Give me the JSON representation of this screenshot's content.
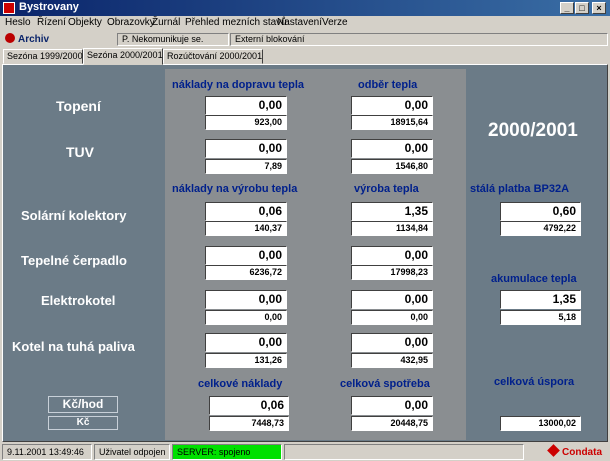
{
  "window": {
    "title": "Bystrovany"
  },
  "menu": [
    "Heslo",
    "Řízení",
    "Objekty",
    "Obrazovky",
    "Žurnál",
    "Přehled mezních stavů",
    "Nastavení",
    "Verze"
  ],
  "toolbar": {
    "archiv": "Archiv",
    "field1": "P. Nekomunikuje se.",
    "field2": "Externí blokování"
  },
  "tabs": [
    "Sezóna 1999/2000",
    "Sezóna 2000/2001",
    "Rozúčtování 2000/2001"
  ],
  "season": "2000/2001",
  "headers": {
    "naklady_doprava": "náklady na dopravu tepla",
    "odber": "odběr tepla",
    "naklady_vyroba": "náklady na výrobu tepla",
    "vyroba": "výroba  tepla",
    "stala_platba": "stálá platba BP32A",
    "akumulace": "akumulace tepla",
    "celkove_naklady": "celkové náklady",
    "celkova_spotreba": "celková spotřeba",
    "celkova_uspora": "celková úspora"
  },
  "rows": {
    "topeni": {
      "label": "Topení",
      "c1_top": "0,00",
      "c1_bot": "923,00",
      "c2_top": "0,00",
      "c2_bot": "18915,64"
    },
    "tuv": {
      "label": "TUV",
      "c1_top": "0,00",
      "c1_bot": "7,89",
      "c2_top": "0,00",
      "c2_bot": "1546,80"
    },
    "solar": {
      "label": "Solární kolektory",
      "c1_top": "0,06",
      "c1_bot": "140,37",
      "c2_top": "1,35",
      "c2_bot": "1134,84"
    },
    "cerpadlo": {
      "label": "Tepelné čerpadlo",
      "c1_top": "0,00",
      "c1_bot": "6236,72",
      "c2_top": "0,00",
      "c2_bot": "17998,23"
    },
    "elektro": {
      "label": "Elektrokotel",
      "c1_top": "0,00",
      "c1_bot": "0,00",
      "c2_top": "0,00",
      "c2_bot": "0,00"
    },
    "kotel": {
      "label": "Kotel na tuhá paliva",
      "c1_top": "0,00",
      "c1_bot": "131,26",
      "c2_top": "0,00",
      "c2_bot": "432,95"
    }
  },
  "right": {
    "stala_top": "0,60",
    "stala_bot": "4792,22",
    "akum_top": "1,35",
    "akum_bot": "5,18",
    "uspora": "13000,02"
  },
  "totals": {
    "naklady_top": "0,06",
    "naklady_bot": "7448,73",
    "spotreba_top": "0,00",
    "spotreba_bot": "20448,75"
  },
  "units": {
    "kc_hod": "Kč/hod",
    "kc": "Kč"
  },
  "status": {
    "datetime": "9.11.2001 13:49:46",
    "user": "Uživatel odpojen",
    "server": "SERVER: spojeno",
    "brand": "Condata"
  }
}
